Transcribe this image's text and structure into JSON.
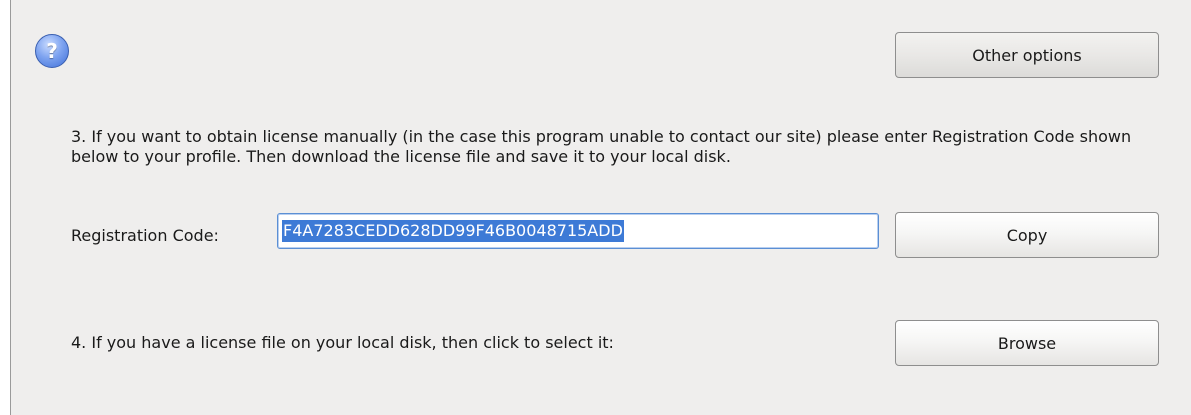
{
  "help": {
    "glyph": "?",
    "icon": "question-icon"
  },
  "buttons": {
    "other_options": "Other options",
    "copy": "Copy",
    "browse": "Browse"
  },
  "step3": {
    "text": "3. If you want to obtain license manually (in the case this program unable to contact our site) please enter Registration Code shown below to your profile. Then download the license file and save it to your local disk."
  },
  "registration": {
    "label": "Registration Code:",
    "code": "F4A7283CEDD628DD99F46B0048715ADD"
  },
  "step4": {
    "text": "4. If you have a license file on your local disk, then click to select it:"
  },
  "colors": {
    "panel_bg": "#efeeed",
    "selection": "#3d7ad6",
    "help_icon": "#3e6fd8"
  }
}
